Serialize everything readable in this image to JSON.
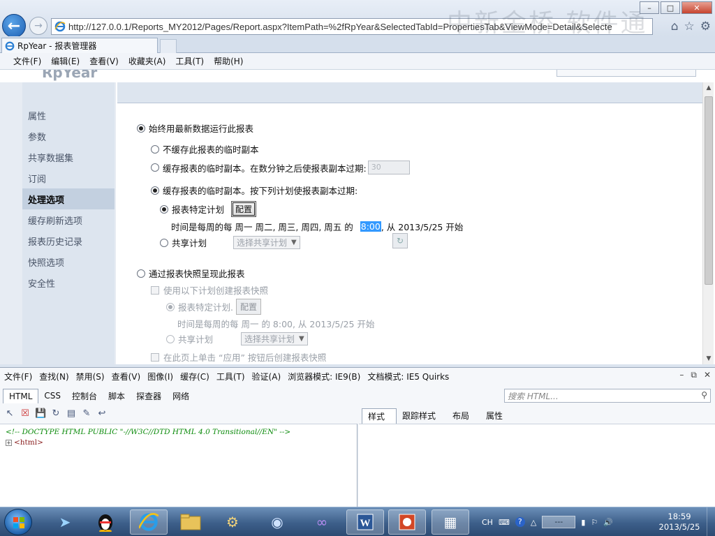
{
  "browser": {
    "address": "http://127.0.0.1/Reports_MY2012/Pages/Report.aspx?ItemPath=%2fRpYear&SelectedTabId=PropertiesTab&ViewMode=Detail&Selecte",
    "tab_title": "RpYear - 报表管理器",
    "watermark": "中新金桥 软件通",
    "menu": [
      "文件(F)",
      "编辑(E)",
      "查看(V)",
      "收藏夹(A)",
      "工具(T)",
      "帮助(H)"
    ],
    "icons": [
      "back-arrow-icon",
      "forward-arrow-icon",
      "home-icon",
      "star-icon",
      "gear-icon"
    ],
    "window_controls": [
      "minimize",
      "maximize",
      "close"
    ]
  },
  "page": {
    "ghost_title": "RpYear",
    "nav": [
      {
        "label": "属性",
        "active": false
      },
      {
        "label": "参数",
        "active": false
      },
      {
        "label": "共享数据集",
        "active": false
      },
      {
        "label": "订阅",
        "active": false
      },
      {
        "label": "处理选项",
        "active": true
      },
      {
        "label": "缓存刷新选项",
        "active": false
      },
      {
        "label": "报表历史记录",
        "active": false
      },
      {
        "label": "快照选项",
        "active": false
      },
      {
        "label": "安全性",
        "active": false
      }
    ],
    "options": {
      "always_latest": "始终用最新数据运行此报表",
      "no_cache": "不缓存此报表的临时副本",
      "cache_minutes": "缓存报表的临时副本。在数分钟之后使报表副本过期:",
      "cache_minutes_value": "30",
      "cache_schedule": "缓存报表的临时副本。按下列计划使报表副本过期:",
      "report_schedule": "报表特定计划",
      "configure_button": "配置",
      "schedule_desc_prefix": "时间是每周的每  周一  周二, 周三, 周四, 周五  的",
      "schedule_time": "8:00",
      "schedule_desc_suffix": ", 从  2013/5/25  开始",
      "shared_schedule": "共享计划",
      "shared_schedule_select": "选择共享计划",
      "snapshot": "通过报表快照呈现此报表",
      "snapshot_create": "使用以下计划创建报表快照",
      "snapshot_report_schedule": "报表特定计划.",
      "snapshot_configure_button": "配置",
      "snapshot_desc": "时间是每周的每  周一  的  8:00, 从  2013/5/25  开始",
      "snapshot_shared": "共享计划",
      "snapshot_shared_select": "选择共享计划",
      "snapshot_apply": "在此页上单击 “应用” 按钮后创建报表快照"
    }
  },
  "devtools": {
    "menu": [
      "文件(F)",
      "查找(N)",
      "禁用(S)",
      "查看(V)",
      "图像(I)",
      "缓存(C)",
      "工具(T)",
      "验证(A)",
      "浏览器模式: IE9(B)",
      "文档模式: IE5 Quirks"
    ],
    "tabs": [
      {
        "label": "HTML",
        "active": true
      },
      {
        "label": "CSS",
        "active": false
      },
      {
        "label": "控制台",
        "active": false
      },
      {
        "label": "脚本",
        "active": false
      },
      {
        "label": "探查器",
        "active": false
      },
      {
        "label": "网络",
        "active": false
      }
    ],
    "search_placeholder": "搜索 HTML...",
    "code_comment": "<!-- DOCTYPE HTML PUBLIC \"-//W3C//DTD HTML 4.0 Transitional//EN\"  -->",
    "code_html": "<html>",
    "side_tabs": [
      {
        "label": "样式",
        "active": true
      },
      {
        "label": "跟踪样式",
        "active": false
      },
      {
        "label": "布局",
        "active": false
      },
      {
        "label": "属性",
        "active": false
      }
    ]
  },
  "taskbar": {
    "apps": [
      "start-orb",
      "qq-bird-icon",
      "qq-penguin-icon",
      "internet-explorer-icon",
      "file-explorer-icon",
      "network-tool-icon",
      "remote-desktop-icon",
      "visual-studio-icon",
      "word-icon",
      "powerpoint-icon",
      "report-tool-icon"
    ],
    "language": "CH",
    "tray_box": "---",
    "time": "18:59",
    "date": "2013/5/25"
  }
}
